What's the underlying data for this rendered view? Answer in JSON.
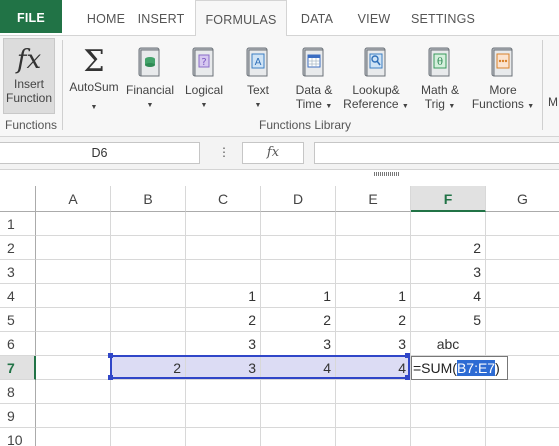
{
  "tabs": {
    "file": "FILE",
    "home": "HOME",
    "insert": "INSERT",
    "formulas": "FORMULAS",
    "data": "DATA",
    "view": "VIEW",
    "settings": "SETTINGS"
  },
  "ribbon": {
    "insert_function": {
      "line1": "Insert",
      "line2": "Function",
      "icon": "fx-icon"
    },
    "autosum": {
      "label": "AutoSum",
      "icon": "sigma-icon"
    },
    "financial": {
      "label": "Financial",
      "icon": "financial-book-icon"
    },
    "logical": {
      "label": "Logical",
      "icon": "logical-book-icon"
    },
    "text": {
      "label": "Text",
      "icon": "text-book-icon"
    },
    "date_time": {
      "line1": "Data &",
      "line2": "Time",
      "icon": "calendar-book-icon"
    },
    "lookup_reference": {
      "line1": "Lookup&",
      "line2": "Reference",
      "icon": "lookup-book-icon"
    },
    "math_trig": {
      "line1": "Math &",
      "line2": "Trig",
      "icon": "math-book-icon"
    },
    "more_functions": {
      "line1": "More",
      "line2": "Functions",
      "icon": "more-book-icon"
    },
    "cut_off_label": "M",
    "group_functions": "Functions",
    "group_library": "Functions Library"
  },
  "formula_bar": {
    "name_box": "D6",
    "fx_label": "fx",
    "value": ""
  },
  "sheet": {
    "columns": [
      "A",
      "B",
      "C",
      "D",
      "E",
      "F",
      "G"
    ],
    "selected_column": "F",
    "rows": [
      "1",
      "2",
      "3",
      "4",
      "5",
      "6",
      "7",
      "8",
      "9",
      "10"
    ],
    "selected_row": "7",
    "cells": {
      "F2": "2",
      "F3": "3",
      "C4": "1",
      "D4": "1",
      "E4": "1",
      "F4": "4",
      "C5": "2",
      "D5": "2",
      "E5": "2",
      "F5": "5",
      "C6": "3",
      "D6": "3",
      "E6": "3",
      "F6": "abc",
      "B7": "2",
      "C7": "3",
      "D7": "4",
      "E7": "4"
    },
    "editing": {
      "cell": "F7",
      "prefix": "=SUM(",
      "reference": "B7:E7",
      "suffix": ")"
    }
  },
  "colors": {
    "accent": "#217346",
    "range_border": "#3046c8",
    "range_fill": "#dcdcf4",
    "reference_highlight": "#2d6bd3"
  }
}
